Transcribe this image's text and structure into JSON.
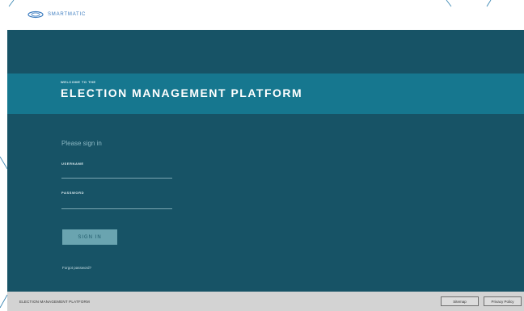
{
  "header": {
    "brand": "SMARTMATIC"
  },
  "banner": {
    "welcome": "WELCOME TO THE",
    "title": "ELECTION MANAGEMENT PLATFORM"
  },
  "login": {
    "heading": "Please sign in",
    "username_label": "USERNAME",
    "password_label": "PASSWORD",
    "submit_label": "SIGN IN",
    "forgot_label": "Forgot password?"
  },
  "footer": {
    "title": "ELECTION MANAGEMENT PLATFORM",
    "sitemap_label": "Sitemap",
    "privacy_label": "Privacy Policy"
  },
  "colors": {
    "background": "#175366",
    "banner": "#16778f",
    "button": "#6aa4b0",
    "footer": "#d3d3d3",
    "brand": "#3a7bbf"
  }
}
